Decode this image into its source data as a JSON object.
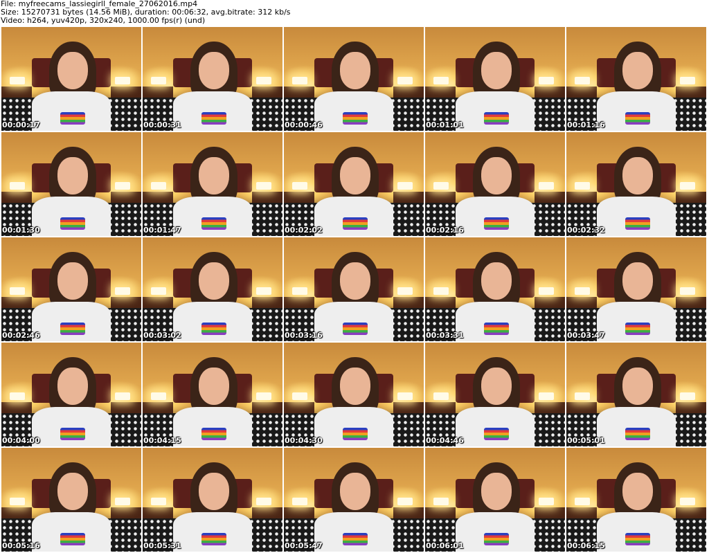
{
  "header": {
    "file_line": "File: myfreecams_lassiegirll_female_27062016.mp4",
    "size_line": "Size: 15270731 bytes (14.56 MiB), duration: 00:06:32, avg.bitrate: 312 kb/s",
    "video_line": "Video: h264, yuv420p, 320x240, 1000.00 fps(r) (und)"
  },
  "thumbnails": [
    {
      "timestamp": "00:00:17"
    },
    {
      "timestamp": "00:00:31"
    },
    {
      "timestamp": "00:00:46"
    },
    {
      "timestamp": "00:01:01"
    },
    {
      "timestamp": "00:01:16"
    },
    {
      "timestamp": "00:01:30"
    },
    {
      "timestamp": "00:01:47"
    },
    {
      "timestamp": "00:02:02"
    },
    {
      "timestamp": "00:02:16"
    },
    {
      "timestamp": "00:02:32"
    },
    {
      "timestamp": "00:02:46"
    },
    {
      "timestamp": "00:03:02"
    },
    {
      "timestamp": "00:03:16"
    },
    {
      "timestamp": "00:03:31"
    },
    {
      "timestamp": "00:03:47"
    },
    {
      "timestamp": "00:04:00"
    },
    {
      "timestamp": "00:04:15"
    },
    {
      "timestamp": "00:04:30"
    },
    {
      "timestamp": "00:04:46"
    },
    {
      "timestamp": "00:05:01"
    },
    {
      "timestamp": "00:05:16"
    },
    {
      "timestamp": "00:05:31"
    },
    {
      "timestamp": "00:05:47"
    },
    {
      "timestamp": "00:06:01"
    },
    {
      "timestamp": "00:06:15"
    }
  ]
}
